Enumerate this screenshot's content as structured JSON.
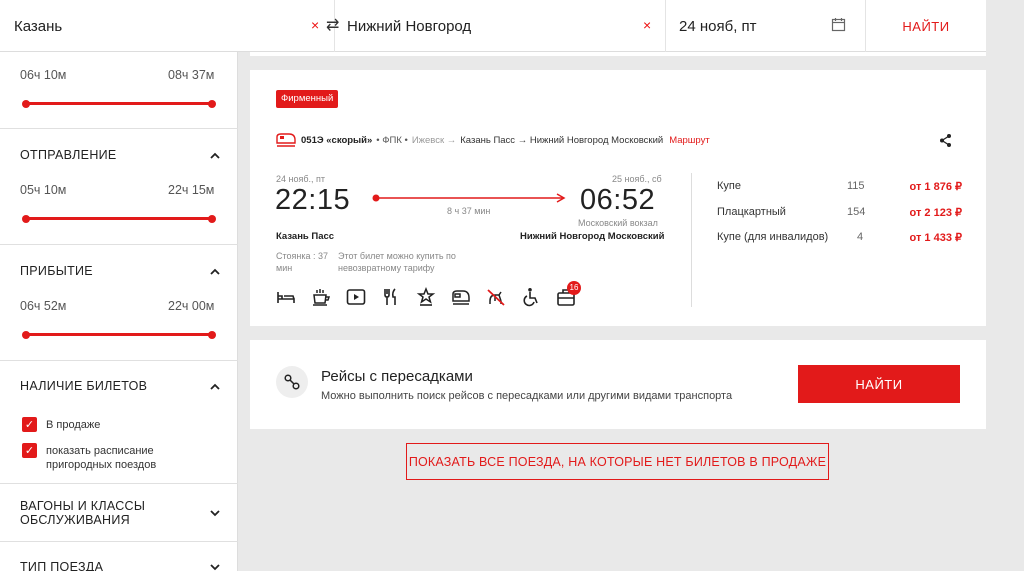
{
  "search": {
    "from": "Казань",
    "to": "Нижний Новгород",
    "date": "24 нояб, пт",
    "clear_icon": "×",
    "swap_icon": "⇄",
    "find_label": "НАЙТИ"
  },
  "sidebar": {
    "travel_time": {
      "min": "06ч 10м",
      "max": "08ч 37м"
    },
    "departure": {
      "title": "ОТПРАВЛЕНИЕ",
      "min": "05ч 10м",
      "max": "22ч 15м"
    },
    "arrival": {
      "title": "ПРИБЫТИЕ",
      "min": "06ч 52м",
      "max": "22ч 00м"
    },
    "tickets": {
      "title": "НАЛИЧИЕ БИЛЕТОВ",
      "opt1": "В продаже",
      "opt2a": "показать расписание",
      "opt2b": "пригородных поездов"
    },
    "cars": {
      "title_a": "ВАГОНЫ И КЛАССЫ",
      "title_b": "ОБСЛУЖИВАНИЯ"
    },
    "train_type": {
      "title": "ТИП ПОЕЗДА"
    }
  },
  "train": {
    "badge": "Фирменный",
    "number": "051Э «скорый»",
    "carrier": "• ФПК •",
    "route_start": "Ижевск →",
    "route_mid": "Казань Пасс → Нижний Новгород Московский",
    "route_link": "Маршрут",
    "dep_date": "24 нояб., пт",
    "dep_time": "22:15",
    "duration": "8 ч 37 мин",
    "arr_date": "25 нояб., сб",
    "arr_time": "06:52",
    "arr_station_note": "Московский вокзал",
    "dep_station": "Казань Пасс",
    "arr_station": "Нижний Новгород Московский",
    "stop_a": "Стоянка : 37",
    "stop_b": "мин",
    "note_a": "Этот билет можно купить по",
    "note_b": "невозвратному тарифу",
    "luggage_badge": "16",
    "prices": [
      {
        "class": "Купе",
        "seats": "115",
        "price": "от 1 876 ₽"
      },
      {
        "class": "Плацкартный",
        "seats": "154",
        "price": "от 2 123 ₽"
      },
      {
        "class": "Купе (для инвалидов)",
        "seats": "4",
        "price": "от 1 433 ₽"
      }
    ]
  },
  "transfers": {
    "title": "Рейсы с пересадками",
    "subtitle": "Можно выполнить поиск рейсов с пересадками или другими видами транспорта",
    "button": "НАЙТИ"
  },
  "show_all": "ПОКАЗАТЬ ВСЕ ПОЕЗДА, НА КОТОРЫЕ НЕТ БИЛЕТОВ В ПРОДАЖЕ",
  "colors": {
    "accent": "#e21a1a",
    "bg": "#e9e9e9"
  }
}
